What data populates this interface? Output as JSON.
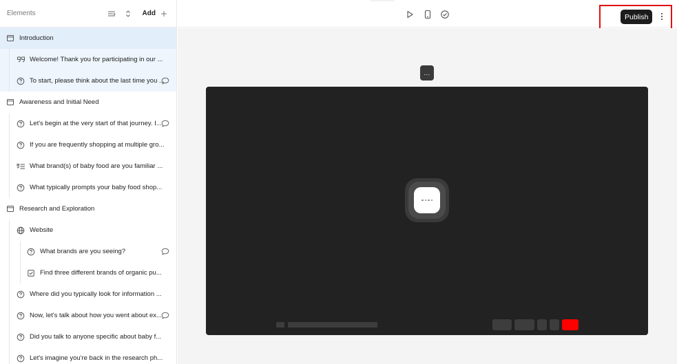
{
  "sidebar": {
    "title": "Elements",
    "add_label": "Add",
    "items": [
      {
        "label": "Introduction",
        "icon": "section-icon",
        "level": 0,
        "comment": false
      },
      {
        "label": "Welcome! Thank you for participating in our ...",
        "icon": "quote-icon",
        "level": 1,
        "comment": false
      },
      {
        "label": "To start, please think about the last time you ...",
        "icon": "question-icon",
        "level": 1,
        "comment": true
      },
      {
        "label": "Awareness and Initial Need",
        "icon": "section-icon",
        "level": 0,
        "comment": false
      },
      {
        "label": "Let's begin at the very start of that journey. I...",
        "icon": "question-icon",
        "level": 1,
        "comment": true
      },
      {
        "label": "If you are frequently shopping at multiple gro...",
        "icon": "question-icon",
        "level": 1,
        "comment": false
      },
      {
        "label": "What brand(s) of baby food are you familiar ...",
        "icon": "list-icon",
        "level": 1,
        "comment": false
      },
      {
        "label": "What typically prompts your baby food shop...",
        "icon": "question-icon",
        "level": 1,
        "comment": false
      },
      {
        "label": "Research and Exploration",
        "icon": "section-icon",
        "level": 0,
        "comment": false
      },
      {
        "label": "Website",
        "icon": "globe-icon",
        "level": 1,
        "comment": false
      },
      {
        "label": "What brands are you seeing?",
        "icon": "question-icon",
        "level": 2,
        "comment": true
      },
      {
        "label": "Find three different brands of organic pu...",
        "icon": "task-icon",
        "level": 2,
        "comment": false
      },
      {
        "label": "Where did you typically look for information ...",
        "icon": "question-icon",
        "level": 1,
        "comment": false
      },
      {
        "label": "Now, let's talk about how you went about ex...",
        "icon": "question-icon",
        "level": 1,
        "comment": true
      },
      {
        "label": "Did you talk to anyone specific about baby f...",
        "icon": "question-icon",
        "level": 1,
        "comment": false
      },
      {
        "label": "Let's imagine you're back in the research ph...",
        "icon": "question-icon",
        "level": 1,
        "comment": false
      }
    ]
  },
  "toolbar": {
    "publish_label": "Publish",
    "play_icon": "play-icon",
    "mobile_icon": "mobile-icon",
    "check_icon": "check-circle-icon",
    "more_icon": "more-vertical-icon"
  },
  "canvas": {
    "menu_label": "...",
    "accent_color": "#ff0000"
  }
}
